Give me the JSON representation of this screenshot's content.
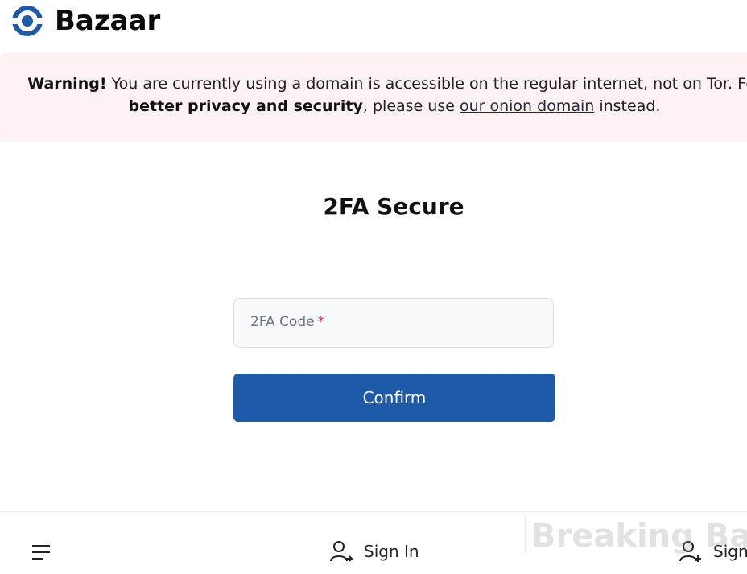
{
  "header": {
    "brand": "Bazaar",
    "logo_icon": "bazaar-logo-icon"
  },
  "warning": {
    "label": "Warning!",
    "text_part1": " You are currently using a domain is accessible on the regular internet, not on Tor. For",
    "emphasis": "better privacy and security",
    "text_part2": ", please use ",
    "link_text": "our onion domain",
    "text_part3": " instead."
  },
  "main": {
    "title": "2FA Secure",
    "code_field": {
      "label": "2FA Code",
      "required_marker": "*",
      "value": ""
    },
    "confirm_label": "Confirm"
  },
  "footer": {
    "menu_icon": "hamburger-menu-icon",
    "sign_in_label": "Sign In",
    "sign_up_label": "Sign"
  },
  "watermark": {
    "text": "Breaking Bad"
  },
  "colors": {
    "brand_blue": "#1d5aa8",
    "warning_bg": "#fdf2f2",
    "required": "#e11d48"
  }
}
